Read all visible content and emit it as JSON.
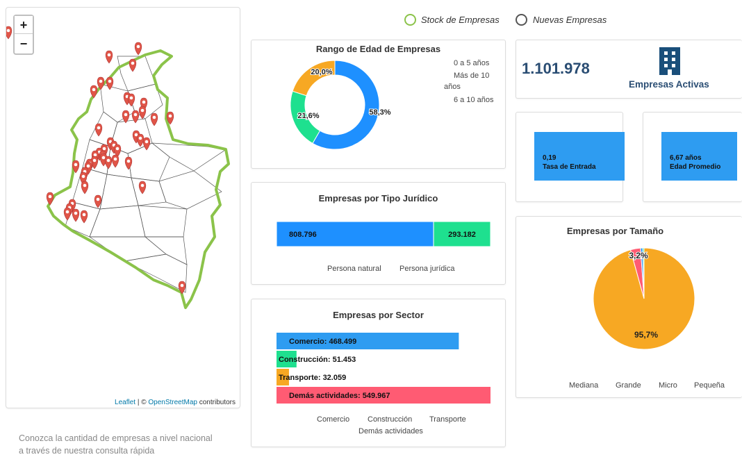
{
  "header": {
    "toggle": [
      {
        "label": "Stock de Empresas",
        "selected": true,
        "color": "#8bc34a"
      },
      {
        "label": "Nuevas Empresas",
        "selected": false,
        "color": "#555555"
      }
    ]
  },
  "map": {
    "zoom_in_label": "+",
    "zoom_out_label": "−",
    "attribution": {
      "leaflet": "Leaflet",
      "sep": " | © ",
      "osm": "OpenStreetMap",
      "rest": " contributors"
    },
    "caption_line1": "Conozca la cantidad de empresas a nivel nacional",
    "caption_line2": "a través de nuestra consulta rápida",
    "border_color": "#8bc34a",
    "marker_color": "#e05548",
    "marker_icon": "map-marker-icon"
  },
  "edad": {
    "title": "Rango de Edad de Empresas",
    "legend": [
      "0 a 5 años",
      "Más de 10",
      "años",
      "6 a 10 años"
    ],
    "labels": [
      "58,3%",
      "21,6%",
      "20,0%"
    ],
    "slices": [
      {
        "name": "Más de 10 años",
        "value": 58.3,
        "color": "#1e90ff"
      },
      {
        "name": "6 a 10 años",
        "value": 21.6,
        "color": "#1ee08f"
      },
      {
        "name": "0 a 5 años",
        "value": 20.0,
        "color": "#f7a823"
      }
    ]
  },
  "kpi": {
    "total": "1.101.978",
    "total_label": "Empresas Activas",
    "building_icon": "building-icon",
    "tasa_value": "0,19",
    "tasa_label": "Tasa de Entrada",
    "edad_value": "6,67 años",
    "edad_label": "Edad Promedio"
  },
  "juridico": {
    "title": "Empresas por Tipo Jurídico",
    "bars": [
      {
        "label": "808.796",
        "value": 808796,
        "color": "#1e90ff"
      },
      {
        "label": "293.182",
        "value": 293182,
        "color": "#1ee08f"
      }
    ],
    "legend": [
      "Persona natural",
      "Persona jurídica"
    ]
  },
  "sector": {
    "title": "Empresas por Sector",
    "bars": [
      {
        "label": "Comercio: 468.499",
        "value": 468499,
        "color": "#2e9cf1"
      },
      {
        "label": "Construcción: 51.453",
        "value": 51453,
        "color": "#1ee08f"
      },
      {
        "label": "Transporte: 32.059",
        "value": 32059,
        "color": "#f7a823"
      },
      {
        "label": "Demás actividades: 549.967",
        "value": 549967,
        "color": "#ff5b73"
      }
    ],
    "legend_row1": [
      "Comercio",
      "Construcción",
      "Transporte"
    ],
    "legend_row2": [
      "Demás actividades"
    ]
  },
  "tamano": {
    "title": "Empresas por Tamaño",
    "labels": [
      "3,2%",
      "95,7%"
    ],
    "slices": [
      {
        "name": "Micro",
        "value": 95.7,
        "color": "#f7a823"
      },
      {
        "name": "Pequeña",
        "value": 3.2,
        "color": "#ff5b73"
      },
      {
        "name": "Mediana",
        "value": 0.7,
        "color": "#1e90ff"
      },
      {
        "name": "Grande",
        "value": 0.4,
        "color": "#1ee08f"
      }
    ],
    "legend": [
      "Mediana",
      "Grande",
      "Micro",
      "Pequeña"
    ]
  },
  "chart_data": [
    {
      "type": "pie",
      "title": "Rango de Edad de Empresas",
      "categories": [
        "Más de 10 años",
        "6 a 10 años",
        "0 a 5 años"
      ],
      "values": [
        58.3,
        21.6,
        20.0
      ]
    },
    {
      "type": "bar",
      "title": "Empresas por Tipo Jurídico",
      "categories": [
        "Persona natural",
        "Persona jurídica"
      ],
      "values": [
        808796,
        293182
      ]
    },
    {
      "type": "bar",
      "title": "Empresas por Sector",
      "categories": [
        "Comercio",
        "Construcción",
        "Transporte",
        "Demás actividades"
      ],
      "values": [
        468499,
        51453,
        32059,
        549967
      ]
    },
    {
      "type": "pie",
      "title": "Empresas por Tamaño",
      "categories": [
        "Micro",
        "Pequeña",
        "Mediana",
        "Grande"
      ],
      "values": [
        95.7,
        3.2,
        0.7,
        0.4
      ]
    }
  ]
}
